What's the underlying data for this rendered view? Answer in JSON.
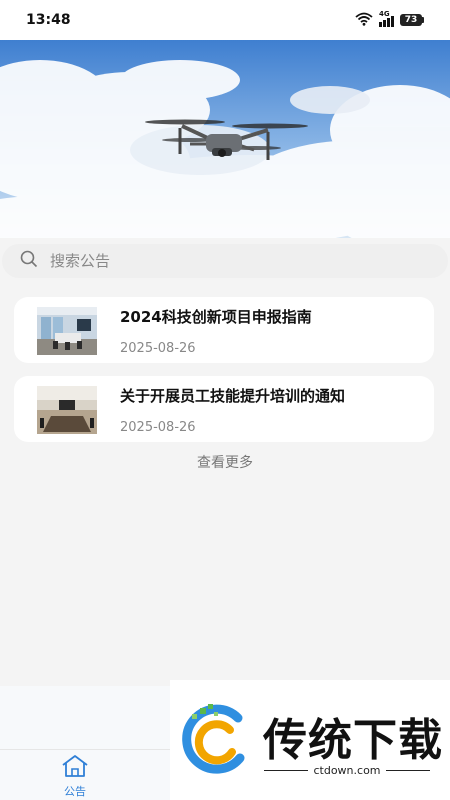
{
  "status_bar": {
    "time": "13:48",
    "network": "4G",
    "battery": "73"
  },
  "banner": {
    "image": "drone-in-sky"
  },
  "search": {
    "placeholder": "搜索公告",
    "value": "",
    "icon": "search-icon"
  },
  "notices": [
    {
      "title": "2024科技创新项目申报指南",
      "date": "2025-08-26",
      "thumbnail": "office-room"
    },
    {
      "title": "关于开展员工技能提升培训的通知",
      "date": "2025-08-26",
      "thumbnail": "meeting-room"
    }
  ],
  "more_label": "查看更多",
  "tab_bar": {
    "items": [
      {
        "label": "公告",
        "icon": "home-icon",
        "active": true
      }
    ],
    "active_color": "#2f7fd6"
  },
  "watermark": {
    "text": "传统下载",
    "url": "ctdown.com"
  }
}
